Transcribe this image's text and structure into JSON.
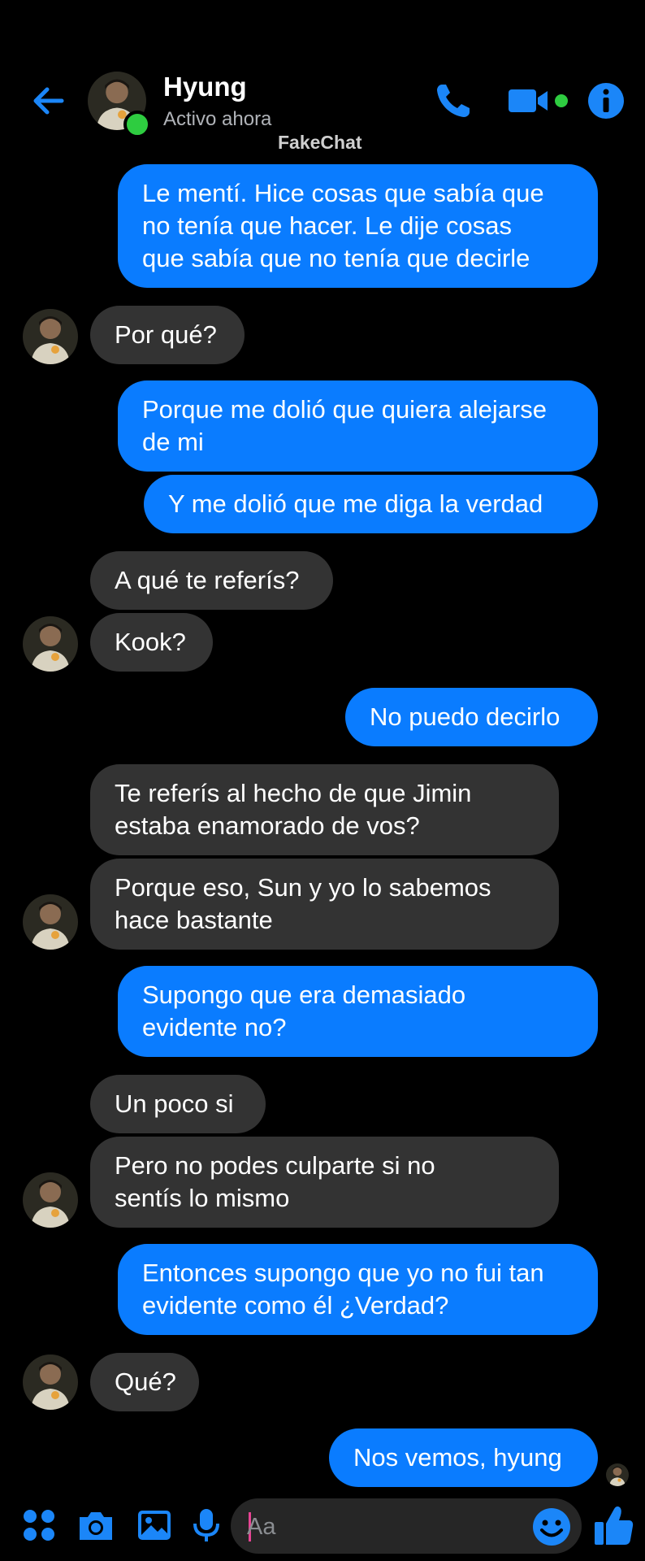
{
  "header": {
    "contact_name": "Hyung",
    "status": "Activo ahora",
    "watermark": "FakeChat"
  },
  "colors": {
    "accent": "#0a7cff",
    "incoming_bubble": "#333333",
    "online": "#2ecc40",
    "background": "#000000"
  },
  "messages": [
    {
      "from": "me",
      "text": "Le mentí. Hice cosas que sabía que\nno tenía que hacer. Le dije cosas\nque sabía que no tenía que decirle"
    },
    {
      "from": "them",
      "text": "Por qué?"
    },
    {
      "from": "me",
      "text": "Porque me dolió que quiera alejarse\nde mi"
    },
    {
      "from": "me",
      "text": "Y me dolió que me diga la verdad"
    },
    {
      "from": "them",
      "text": "A qué te referís?"
    },
    {
      "from": "them",
      "text": "Kook?"
    },
    {
      "from": "me",
      "text": "No puedo decirlo"
    },
    {
      "from": "them",
      "text": "Te referís al hecho de que Jimin\nestaba enamorado de vos?"
    },
    {
      "from": "them",
      "text": "Porque eso, Sun y yo lo sabemos\nhace bastante"
    },
    {
      "from": "me",
      "text": "Supongo que era demasiado\nevidente no?"
    },
    {
      "from": "them",
      "text": "Un poco si"
    },
    {
      "from": "them",
      "text": "Pero no podes culparte si no\nsentís lo mismo"
    },
    {
      "from": "me",
      "text": "Entonces supongo que yo no fui tan\nevidente como él ¿Verdad?"
    },
    {
      "from": "them",
      "text": "Qué?"
    },
    {
      "from": "me",
      "text": "Nos vemos, hyung"
    }
  ],
  "composer": {
    "placeholder": "Aa"
  },
  "icons": {
    "back": "back-arrow-icon",
    "call": "phone-icon",
    "video": "video-camera-icon",
    "info": "info-icon",
    "apps": "apps-grid-icon",
    "camera": "camera-icon",
    "gallery": "image-icon",
    "mic": "microphone-icon",
    "emoji": "emoji-icon",
    "like": "thumbs-up-icon"
  }
}
